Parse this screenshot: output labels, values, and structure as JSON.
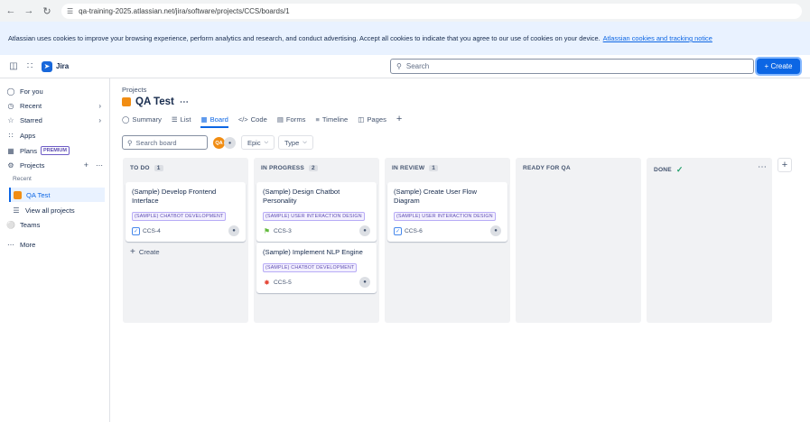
{
  "browser": {
    "url": "qa-training-2025.atlassian.net/jira/software/projects/CCS/boards/1"
  },
  "cookie": {
    "text": "Atlassian uses cookies to improve your browsing experience, perform analytics and research, and conduct advertising. Accept all cookies to indicate that you agree to our use of cookies on your device.",
    "link": "Atlassian cookies and tracking notice"
  },
  "topnav": {
    "app_name": "Jira",
    "search_placeholder": "Search",
    "create_label": "+ Create"
  },
  "sidebar": {
    "for_you": "For you",
    "recent": "Recent",
    "starred": "Starred",
    "apps": "Apps",
    "plans": "Plans",
    "premium": "PREMIUM",
    "projects": "Projects",
    "recent_sub": "Recent",
    "project_name": "QA Test",
    "view_all": "View all projects",
    "teams": "Teams",
    "more": "More"
  },
  "main": {
    "breadcrumb": "Projects",
    "title": "QA Test",
    "tabs": [
      "Summary",
      "List",
      "Board",
      "Code",
      "Forms",
      "Timeline",
      "Pages"
    ],
    "active_tab": "Board",
    "board_search_placeholder": "Search board",
    "avatar_initials": "QA",
    "filters": [
      "Epic",
      "Type"
    ]
  },
  "columns": [
    {
      "name": "TO DO",
      "count": "1",
      "create": "Create",
      "cards": [
        {
          "title": "(Sample) Develop Frontend Interface",
          "label": "(SAMPLE) CHATBOT DEVELOPMENT",
          "key": "CCS-4",
          "type": "task"
        }
      ]
    },
    {
      "name": "IN PROGRESS",
      "count": "2",
      "cards": [
        {
          "title": "(Sample) Design Chatbot Personality",
          "label": "(SAMPLE) USER INTERACTION DESIGN",
          "key": "CCS-3",
          "type": "story"
        },
        {
          "title": "(Sample) Implement NLP Engine",
          "label": "(SAMPLE) CHATBOT DEVELOPMENT",
          "key": "CCS-5",
          "type": "bug"
        }
      ]
    },
    {
      "name": "IN REVIEW",
      "count": "1",
      "cards": [
        {
          "title": "(Sample) Create User Flow Diagram",
          "label": "(SAMPLE) USER INTERACTION DESIGN",
          "key": "CCS-6",
          "type": "task"
        }
      ]
    },
    {
      "name": "READY FOR QA",
      "cards": []
    },
    {
      "name": "DONE",
      "cards": []
    }
  ],
  "colors": {
    "accent": "#0c66e4",
    "task": "#4688ec",
    "story": "#63ba3c",
    "bug": "#e5493a",
    "project": "#f18d13"
  }
}
